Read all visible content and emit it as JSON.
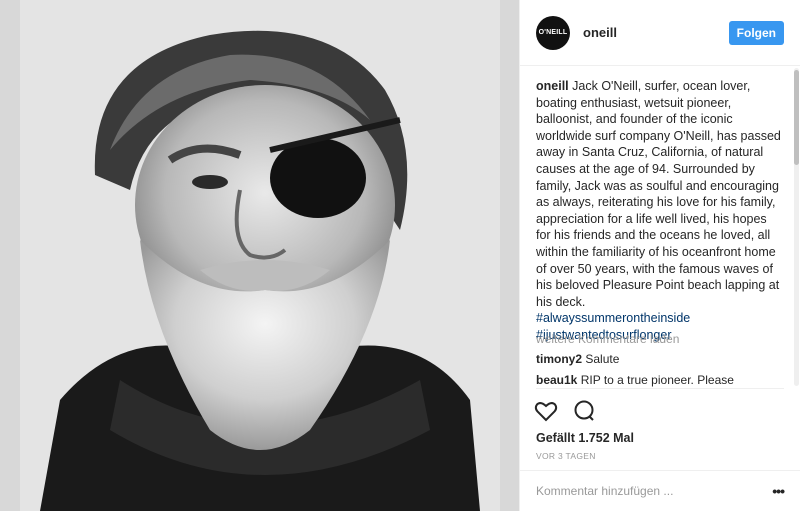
{
  "post": {
    "username": "oneill",
    "avatar_text": "O'NEILL",
    "follow_label": "Folgen"
  },
  "caption": {
    "author": "oneill",
    "text": "Jack O'Neill, surfer, ocean lover, boating enthusiast, wetsuit pioneer, balloonist, and founder of the iconic worldwide surf company O'Neill, has passed away in Santa Cruz, California, of natural causes at the age of 94. Surrounded by family, Jack was as soulful and encouraging as always, reiterating his love for his family, appreciation for a life well lived, his hopes for his friends and the oceans he loved, all within the familiarity of his oceanfront home of over 50 years, with the famous waves of his beloved Pleasure Point beach lapping at his deck.",
    "hashtags": [
      "#alwayssummerontheinside",
      "#ijustwantedtosurflonger"
    ]
  },
  "load_more": "weitere Kommentare laden",
  "comments": [
    {
      "user": "timony2",
      "text": "Salute"
    },
    {
      "user": "beau1k",
      "text": "RIP to a true pioneer. Please"
    }
  ],
  "icons": {
    "like": "heart-icon",
    "comment": "comment-icon",
    "more": "more-options-icon"
  },
  "likes": "Gefällt 1.752 Mal",
  "time": "VOR 3 TAGEN",
  "add_comment_placeholder": "Kommentar hinzufügen ...",
  "colors": {
    "follow_button": "#3897f0",
    "hashtag": "#003569",
    "muted": "#999999"
  }
}
